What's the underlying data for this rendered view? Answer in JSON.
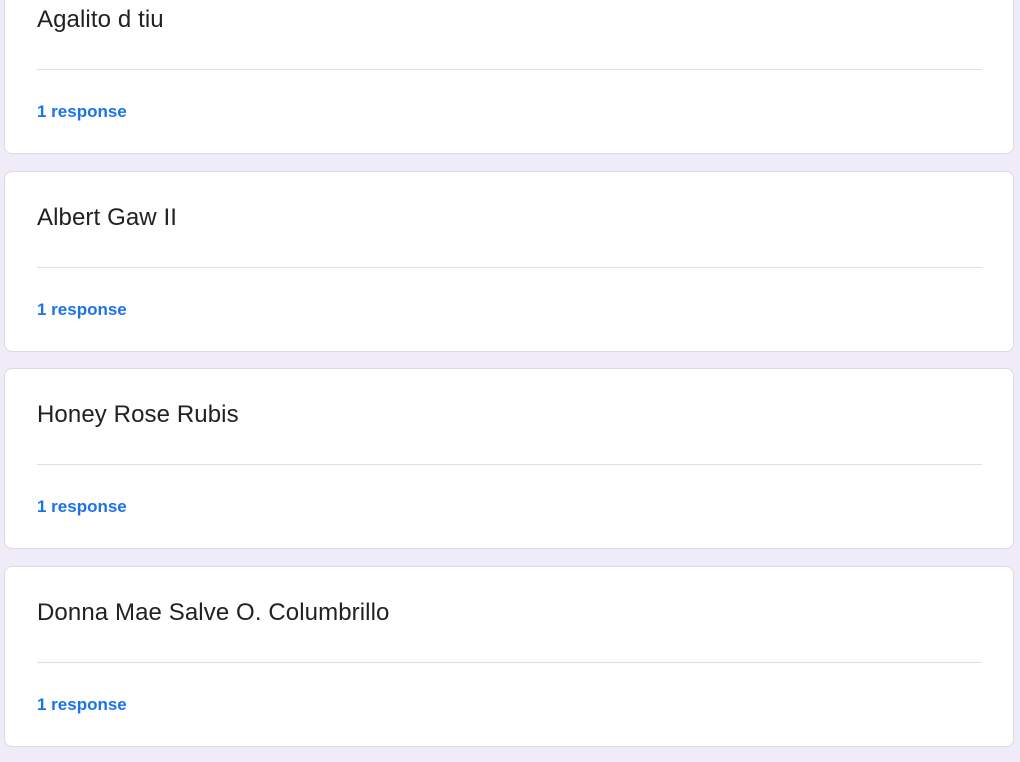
{
  "colors": {
    "page_background": "#efebf8",
    "card_background": "#ffffff",
    "link": "#1a73e8",
    "title_text": "#202124"
  },
  "questions": [
    {
      "title": "Agalito d tiu",
      "responses": "1 response"
    },
    {
      "title": "Albert Gaw II",
      "responses": "1 response"
    },
    {
      "title": "Honey Rose Rubis",
      "responses": "1 response"
    },
    {
      "title": "Donna Mae Salve O. Columbrillo",
      "responses": "1 response"
    }
  ]
}
